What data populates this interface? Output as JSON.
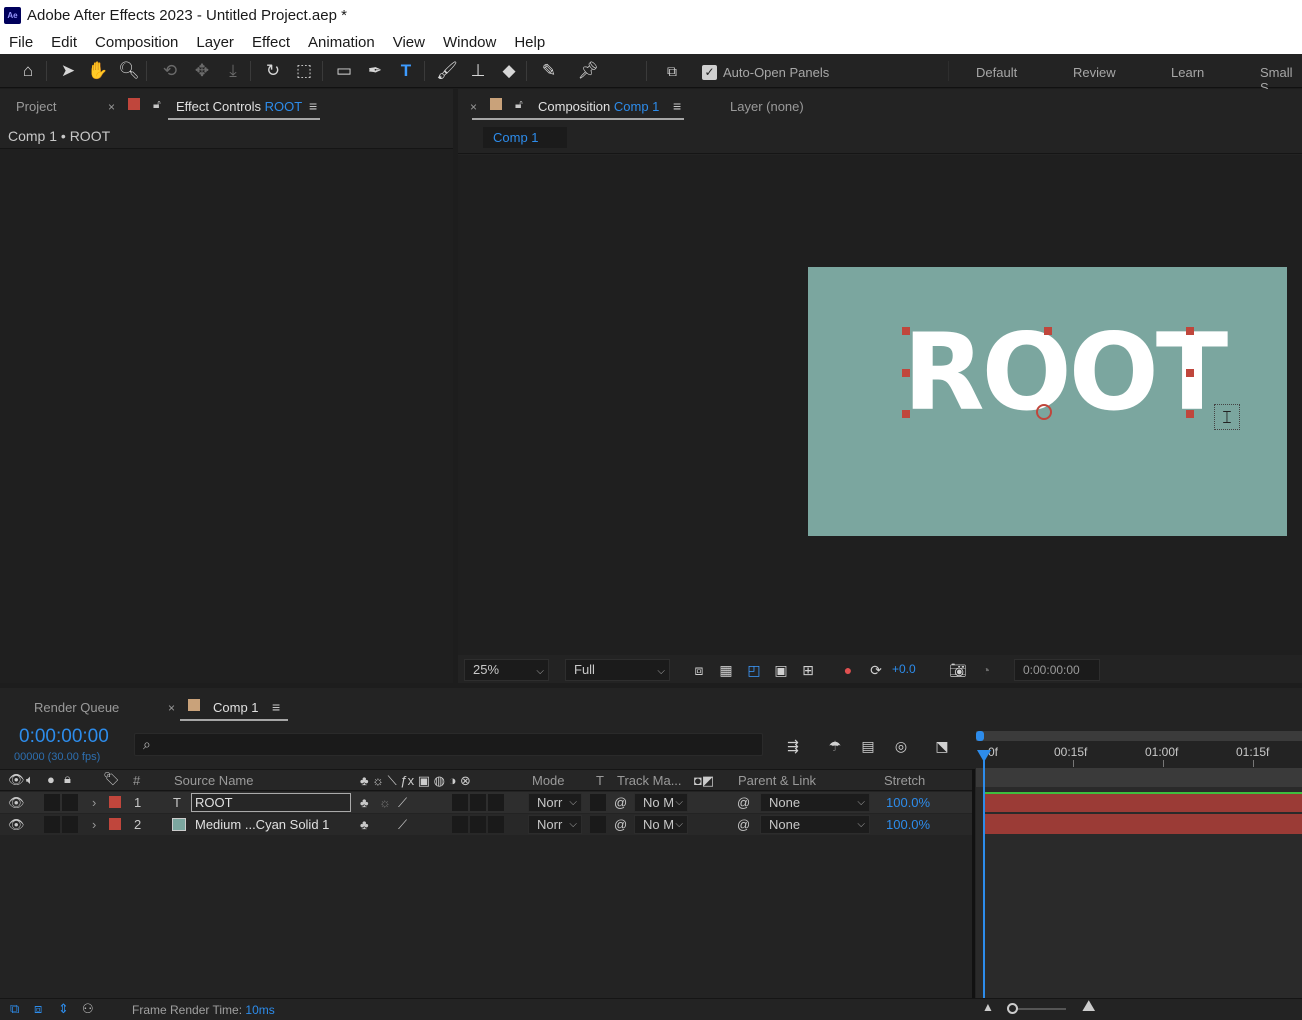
{
  "app": {
    "title": "Adobe After Effects 2023 - Untitled Project.aep *",
    "logo": "Ae"
  },
  "menu": [
    "File",
    "Edit",
    "Composition",
    "Layer",
    "Effect",
    "Animation",
    "View",
    "Window",
    "Help"
  ],
  "toolbar": {
    "auto_open_panels": "Auto-Open Panels",
    "auto_open_checked": true,
    "workspaces": [
      "Default",
      "Review",
      "Learn",
      "Small S"
    ],
    "icons": [
      "home-icon",
      "selection-tool-icon",
      "hand-tool-icon",
      "zoom-tool-icon",
      "orbit-camera-icon",
      "pan-camera-icon",
      "dolly-camera-icon",
      "rotation-tool-icon",
      "pan-behind-tool-icon",
      "rectangle-tool-icon",
      "pen-tool-icon",
      "type-tool-icon",
      "brush-tool-icon",
      "clone-stamp-icon",
      "eraser-tool-icon",
      "roto-brush-icon",
      "puppet-pin-icon",
      "snapping-icon"
    ]
  },
  "left_panel": {
    "tab_project": "Project",
    "tab_effect_controls": "Effect Controls",
    "effect_controls_target": "ROOT",
    "breadcrumb": "Comp 1 • ROOT"
  },
  "comp_panel": {
    "tab_composition": "Composition",
    "comp_name": "Comp 1",
    "tab_layer": "Layer (none)",
    "subtab": "Comp 1",
    "canvas_text": "ROOT",
    "canvas_color": "#7ba69f",
    "zoom": "25%",
    "resolution": "Full",
    "exposure": "+0.0",
    "timecode": "0:00:00:00"
  },
  "timeline": {
    "tab_render_queue": "Render Queue",
    "tab_comp": "Comp 1",
    "current_time": "0:00:00:00",
    "frame_info": "00000 (30.00 fps)",
    "search_placeholder": "",
    "columns": {
      "number": "#",
      "source_name": "Source Name",
      "mode": "Mode",
      "t": "T",
      "track_matte": "Track Ma...",
      "parent_link": "Parent & Link",
      "stretch": "Stretch"
    },
    "ruler": [
      "0f",
      "00:15f",
      "01:00f",
      "01:15f"
    ],
    "layers": [
      {
        "num": "1",
        "type": "T",
        "name": "ROOT",
        "label_color": "#c0463c",
        "mode": "Norr",
        "track": "No M",
        "parent": "None",
        "stretch": "100.0%"
      },
      {
        "num": "2",
        "type": "",
        "name": "Medium ...Cyan Solid 1",
        "label_color": "#c0463c",
        "mode": "Norr",
        "track": "No M",
        "parent": "None",
        "stretch": "100.0%"
      }
    ],
    "bar_color": "#9b3b36",
    "frame_render_label": "Frame Render Time:",
    "frame_render_value": "10ms"
  }
}
